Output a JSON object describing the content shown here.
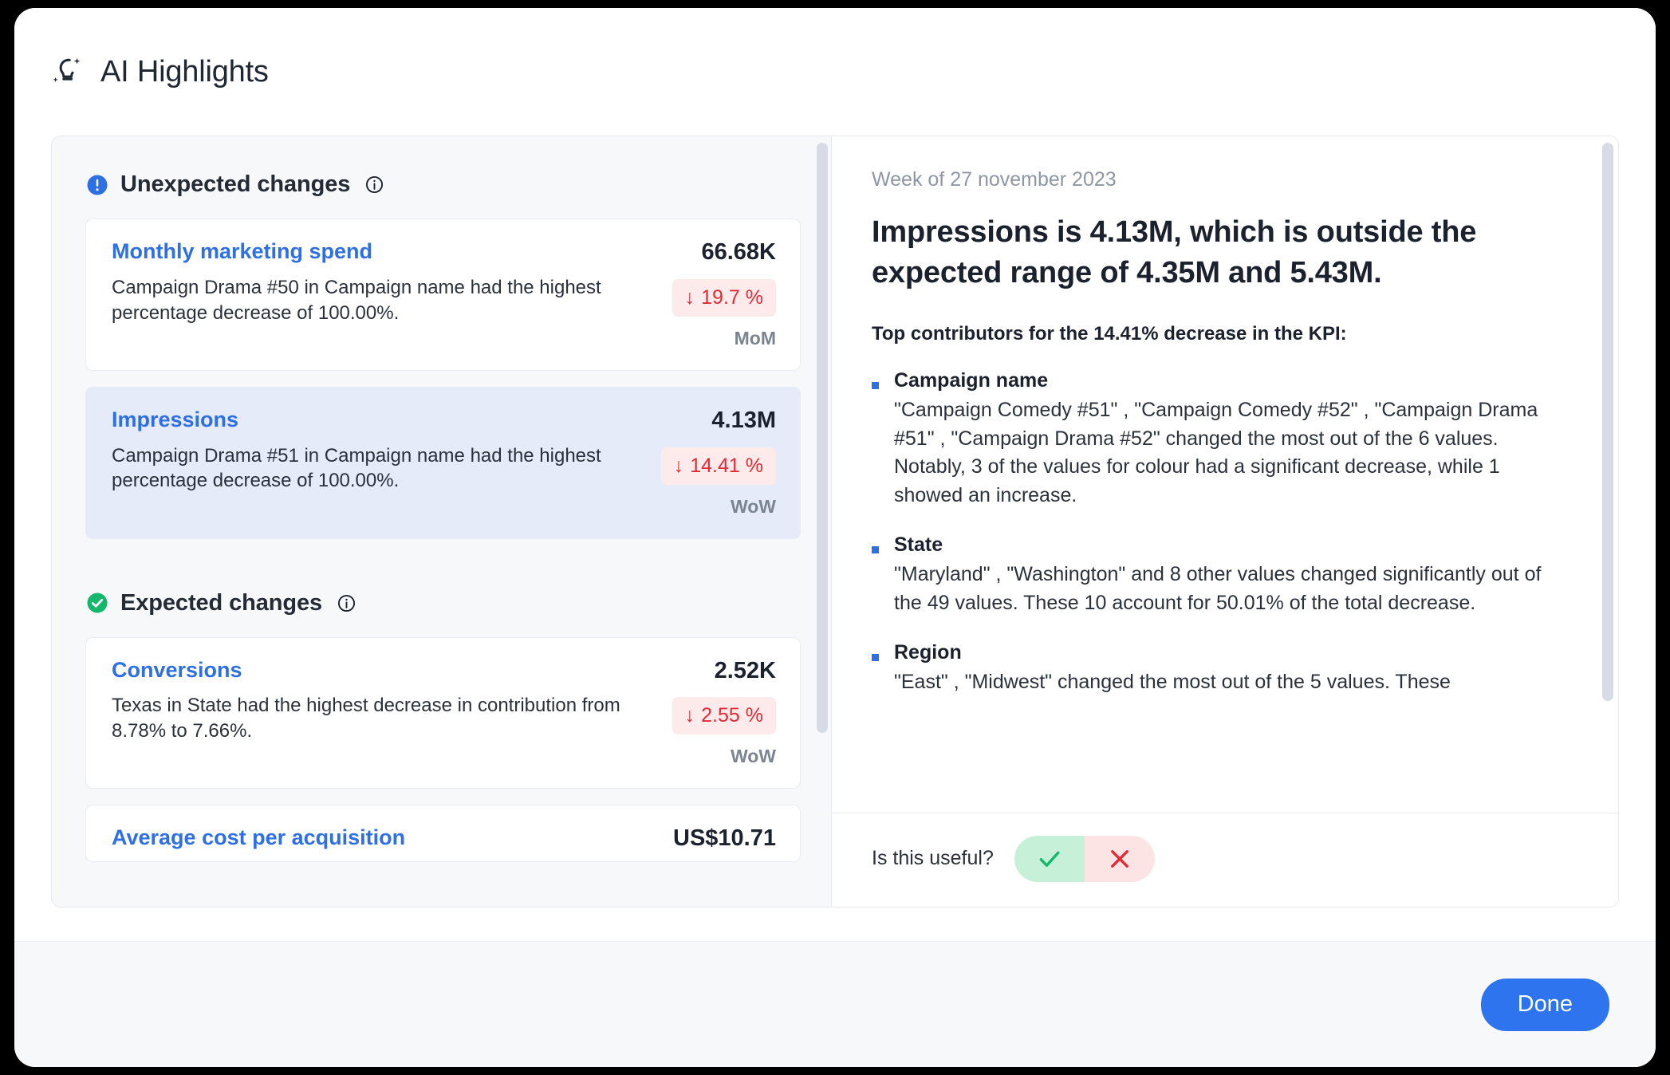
{
  "modal": {
    "title": "AI Highlights",
    "icon": "sparkle-bulb-icon",
    "done_label": "Done"
  },
  "left": {
    "sections": [
      {
        "id": "unexpected",
        "title": "Unexpected changes",
        "badge_icon": "alert-circle-icon",
        "badge_color": "#2f6fe4",
        "info_icon": "info-icon",
        "cards": [
          {
            "name": "Monthly marketing spend",
            "description": "Campaign Drama #50 in Campaign name had the highest percentage decrease of 100.00%.",
            "value": "66.68K",
            "delta": "19.7 %",
            "delta_direction": "↓",
            "delta_color": "#e02b35",
            "period": "MoM",
            "selected": false
          },
          {
            "name": "Impressions",
            "description": "Campaign Drama #51 in Campaign name had the highest percentage decrease of 100.00%.",
            "value": "4.13M",
            "delta": "14.41 %",
            "delta_direction": "↓",
            "delta_color": "#e02b35",
            "period": "WoW",
            "selected": true
          }
        ]
      },
      {
        "id": "expected",
        "title": "Expected changes",
        "badge_icon": "check-circle-icon",
        "badge_color": "#15b86a",
        "info_icon": "info-icon",
        "cards": [
          {
            "name": "Conversions",
            "description": "Texas in State had the highest decrease in contribution from 8.78% to 7.66%.",
            "value": "2.52K",
            "delta": "2.55 %",
            "delta_direction": "↓",
            "delta_color": "#e02b35",
            "period": "WoW",
            "selected": false
          },
          {
            "name": "Average cost per acquisition",
            "description": "",
            "value": "US$10.71",
            "delta": "",
            "delta_direction": "",
            "delta_color": "#e02b35",
            "period": "",
            "selected": false
          }
        ]
      }
    ]
  },
  "right": {
    "week": "Week of 27 november 2023",
    "headline": "Impressions is 4.13M, which is outside the expected range of 4.35M and 5.43M.",
    "contributors_lead": "Top contributors for the 14.41% decrease in the KPI:",
    "contributors": [
      {
        "title": "Campaign name",
        "text": "\"Campaign Comedy #51\" , \"Campaign Comedy #52\" , \"Campaign Drama #51\" , \"Campaign Drama #52\" changed the most out of the 6 values. Notably, 3 of the values for colour had a significant decrease, while 1 showed an increase."
      },
      {
        "title": "State",
        "text": "\"Maryland\" , \"Washington\" and 8 other values changed significantly out of the 49 values. These 10 account for 50.01% of the total decrease."
      },
      {
        "title": "Region",
        "text": "\"East\" , \"Midwest\" changed the most out of the 5 values. These"
      }
    ],
    "feedback": {
      "question": "Is this useful?",
      "yes_icon": "check-icon",
      "no_icon": "close-icon",
      "yes_color": "#15b86a",
      "no_color": "#e02b35"
    }
  }
}
